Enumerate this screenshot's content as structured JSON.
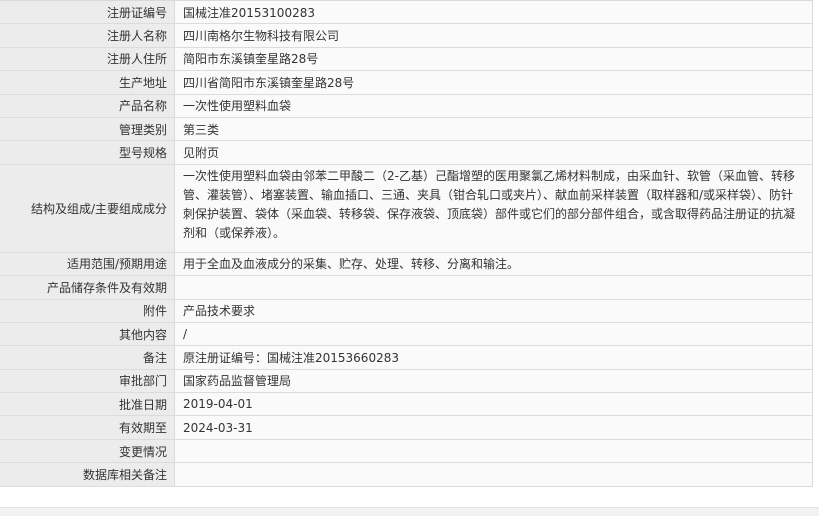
{
  "rows": [
    {
      "label": "注册证编号",
      "value": "国械注准20153100283"
    },
    {
      "label": "注册人名称",
      "value": "四川南格尔生物科技有限公司"
    },
    {
      "label": "注册人住所",
      "value": "简阳市东溪镇奎星路28号"
    },
    {
      "label": "生产地址",
      "value": "四川省简阳市东溪镇奎星路28号"
    },
    {
      "label": "产品名称",
      "value": "一次性使用塑料血袋"
    },
    {
      "label": "管理类别",
      "value": "第三类"
    },
    {
      "label": "型号规格",
      "value": "见附页"
    },
    {
      "label": "结构及组成/主要组成成分",
      "value": "一次性使用塑料血袋由邻苯二甲酸二（2-乙基）己酯增塑的医用聚氯乙烯材料制成，由采血针、软管（采血管、转移管、灌装管）、堵塞装置、输血插口、三通、夹具（钳合轧口或夹片）、献血前采样装置（取样器和/或采样袋）、防针刺保护装置、袋体（采血袋、转移袋、保存液袋、顶底袋）部件或它们的部分部件组合，或含取得药品注册证的抗凝剂和（或保养液）。"
    },
    {
      "label": "适用范围/预期用途",
      "value": "用于全血及血液成分的采集、贮存、处理、转移、分离和输注。"
    },
    {
      "label": "产品储存条件及有效期",
      "value": ""
    },
    {
      "label": "附件",
      "value": "产品技术要求"
    },
    {
      "label": "其他内容",
      "value": "/"
    },
    {
      "label": "备注",
      "value": "原注册证编号：国械注准20153660283"
    },
    {
      "label": "审批部门",
      "value": "国家药品监督管理局"
    },
    {
      "label": "批准日期",
      "value": "2019-04-01"
    },
    {
      "label": "有效期至",
      "value": "2024-03-31"
    },
    {
      "label": "变更情况",
      "value": ""
    },
    {
      "label": "数据库相关备注",
      "value": ""
    }
  ]
}
